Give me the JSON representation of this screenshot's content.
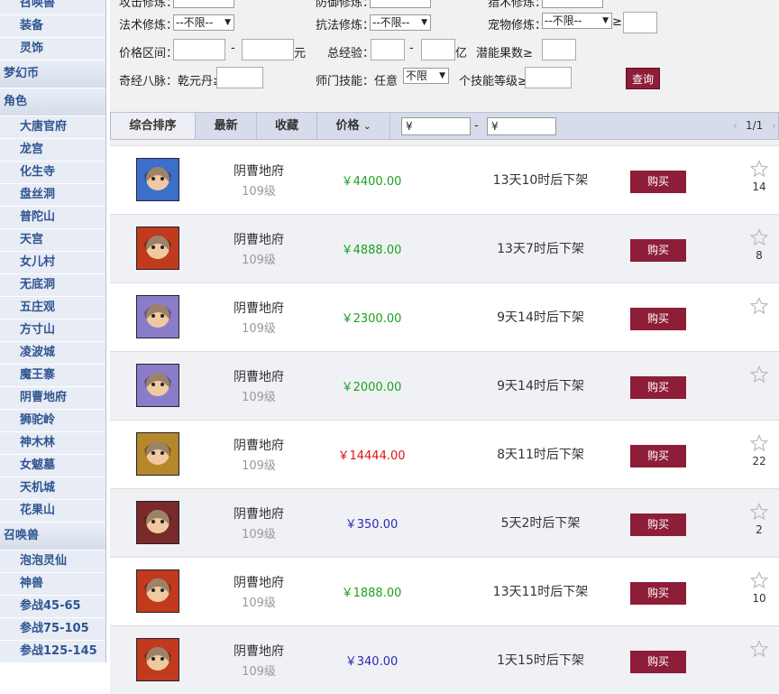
{
  "sidebar": {
    "items": [
      {
        "label": "召唤兽",
        "type": "item"
      },
      {
        "label": "装备",
        "type": "item"
      },
      {
        "label": "灵饰",
        "type": "item"
      },
      {
        "label": "梦幻币",
        "type": "cat"
      },
      {
        "label": "角色",
        "type": "cat"
      },
      {
        "label": "大唐官府",
        "type": "item"
      },
      {
        "label": "龙宫",
        "type": "item"
      },
      {
        "label": "化生寺",
        "type": "item"
      },
      {
        "label": "盘丝洞",
        "type": "item"
      },
      {
        "label": "普陀山",
        "type": "item"
      },
      {
        "label": "天宫",
        "type": "item"
      },
      {
        "label": "女儿村",
        "type": "item"
      },
      {
        "label": "无底洞",
        "type": "item"
      },
      {
        "label": "五庄观",
        "type": "item"
      },
      {
        "label": "方寸山",
        "type": "item"
      },
      {
        "label": "凌波城",
        "type": "item"
      },
      {
        "label": "魔王寨",
        "type": "item"
      },
      {
        "label": "阴曹地府",
        "type": "item"
      },
      {
        "label": "狮驼岭",
        "type": "item"
      },
      {
        "label": "神木林",
        "type": "item"
      },
      {
        "label": "女魃墓",
        "type": "item"
      },
      {
        "label": "天机城",
        "type": "item"
      },
      {
        "label": "花果山",
        "type": "item"
      },
      {
        "label": "召唤兽",
        "type": "cat"
      },
      {
        "label": "泡泡灵仙",
        "type": "item"
      },
      {
        "label": "神兽",
        "type": "item"
      },
      {
        "label": "参战45-65",
        "type": "item"
      },
      {
        "label": "参战75-105",
        "type": "item"
      },
      {
        "label": "参战125-145",
        "type": "item"
      }
    ]
  },
  "filters": {
    "top_partial_1": "攻击修炼：",
    "top_partial_2": "防御修炼：",
    "top_partial_3": "猎术修炼：",
    "magic_label": "法术修炼：",
    "magic_value": "--不限--",
    "resist_label": "抗法修炼：",
    "resist_value": "--不限--",
    "pet_label": "宠物修炼：",
    "pet_value": "--不限--",
    "gte": "≥",
    "price_label": "价格区间：",
    "price_unit": "元",
    "dash": "-",
    "exp_label": "总经验：",
    "exp_unit": "亿",
    "potential_label": "潜能果数≥",
    "meridian_label": "奇经八脉：乾元丹≥",
    "sect_skill_label": "师门技能：任意",
    "sect_skill_value": "不限",
    "skill_level_label": "个技能等级≥",
    "query_button": "查询"
  },
  "sortbar": {
    "tabs": [
      "综合排序",
      "最新",
      "收藏",
      "价格"
    ],
    "price_min_placeholder": "¥",
    "price_max_placeholder": "¥",
    "dash": "-",
    "pager": "1/1",
    "pager_prev": "‹",
    "pager_next": "›"
  },
  "listings": [
    {
      "school": "阴曹地府",
      "level": "109级",
      "price": "￥4400.00",
      "price_color": "#1aa31a",
      "time_left": "13天10时后下架",
      "buy": "购买",
      "favorites": "14",
      "avatar_color": "#3b6fc9"
    },
    {
      "school": "阴曹地府",
      "level": "109级",
      "price": "￥4888.00",
      "price_color": "#1aa31a",
      "time_left": "13天7时后下架",
      "buy": "购买",
      "favorites": "8",
      "avatar_color": "#c23a1e"
    },
    {
      "school": "阴曹地府",
      "level": "109级",
      "price": "￥2300.00",
      "price_color": "#1aa31a",
      "time_left": "9天14时后下架",
      "buy": "购买",
      "favorites": "",
      "avatar_color": "#8a7cc8"
    },
    {
      "school": "阴曹地府",
      "level": "109级",
      "price": "￥2000.00",
      "price_color": "#1aa31a",
      "time_left": "9天14时后下架",
      "buy": "购买",
      "favorites": "",
      "avatar_color": "#8a7cc8"
    },
    {
      "school": "阴曹地府",
      "level": "109级",
      "price": "￥14444.00",
      "price_color": "#e01010",
      "time_left": "8天11时后下架",
      "buy": "购买",
      "favorites": "22",
      "avatar_color": "#b5892a"
    },
    {
      "school": "阴曹地府",
      "level": "109级",
      "price": "￥350.00",
      "price_color": "#2a2ab8",
      "time_left": "5天2时后下架",
      "buy": "购买",
      "favorites": "2",
      "avatar_color": "#7a2a2a"
    },
    {
      "school": "阴曹地府",
      "level": "109级",
      "price": "￥1888.00",
      "price_color": "#1aa31a",
      "time_left": "13天11时后下架",
      "buy": "购买",
      "favorites": "10",
      "avatar_color": "#c23a1e"
    },
    {
      "school": "阴曹地府",
      "level": "109级",
      "price": "￥340.00",
      "price_color": "#2a2ab8",
      "time_left": "1天15时后下架",
      "buy": "购买",
      "favorites": "",
      "avatar_color": "#c23a1e"
    }
  ]
}
